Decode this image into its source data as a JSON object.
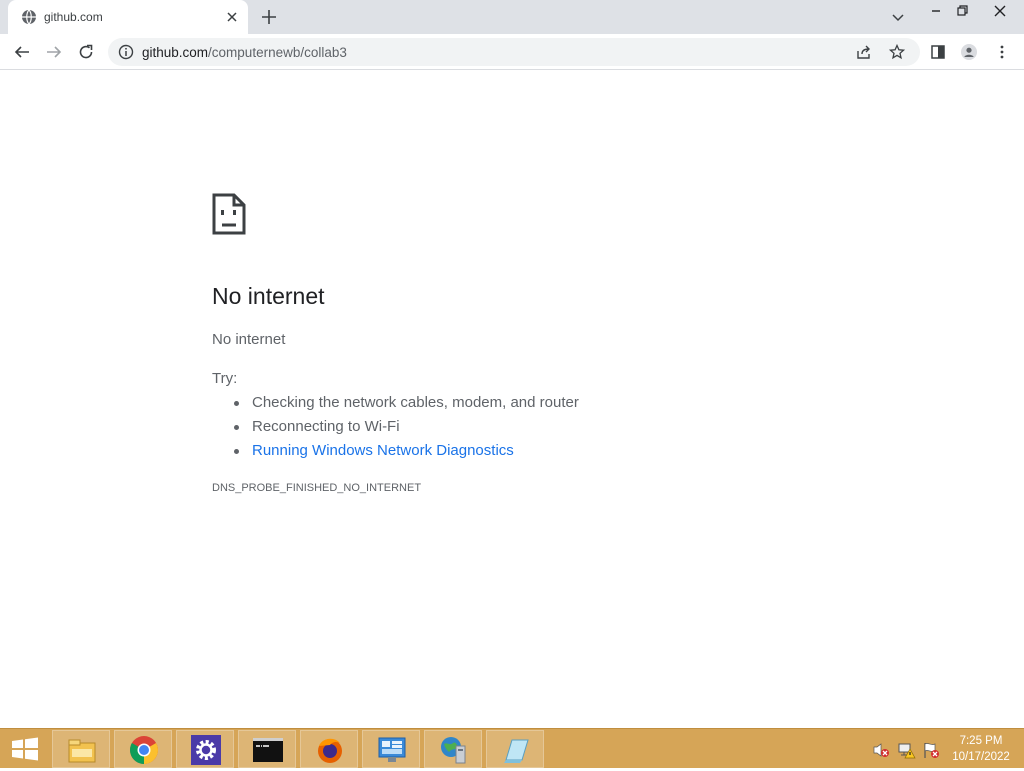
{
  "browser": {
    "tab": {
      "title": "github.com"
    },
    "address": {
      "host": "github.com",
      "path": "/computernewb/collab3"
    }
  },
  "error_page": {
    "heading": "No internet",
    "subtitle": "No internet",
    "try_label": "Try:",
    "suggestions": [
      "Checking the network cables, modem, and router",
      "Reconnecting to Wi-Fi",
      "Running Windows Network Diagnostics"
    ],
    "error_code": "DNS_PROBE_FINISHED_NO_INTERNET"
  },
  "taskbar": {
    "apps": [
      "file-explorer-icon",
      "chrome-icon",
      "settings-icon",
      "command-prompt-icon",
      "firefox-icon",
      "control-panel-icon",
      "network-tool-icon",
      "notepad-icon"
    ],
    "clock": {
      "time": "7:25 PM",
      "date": "10/17/2022"
    }
  },
  "colors": {
    "taskbar": "#d6a557",
    "link": "#1a73e8",
    "tabstrip": "#dee1e6"
  }
}
